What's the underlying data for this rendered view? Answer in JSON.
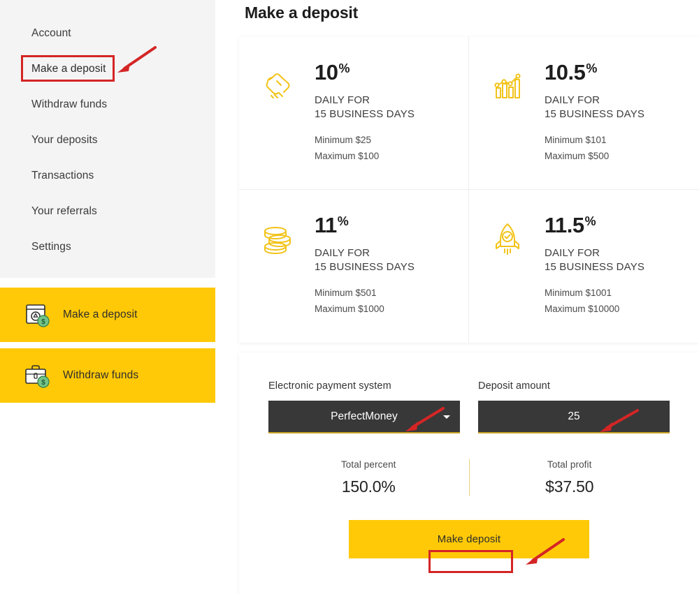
{
  "sidebar": {
    "nav_items": [
      {
        "label": "Account",
        "active": false
      },
      {
        "label": "Make a deposit",
        "active": true
      },
      {
        "label": "Withdraw funds",
        "active": false
      },
      {
        "label": "Your deposits",
        "active": false
      },
      {
        "label": "Transactions",
        "active": false
      },
      {
        "label": "Your referrals",
        "active": false
      },
      {
        "label": "Settings",
        "active": false
      }
    ],
    "action_buttons": [
      {
        "label": "Make a deposit",
        "icon": "deposit-bag-dollar-icon"
      },
      {
        "label": "Withdraw funds",
        "icon": "briefcase-dollar-icon"
      }
    ]
  },
  "main": {
    "page_title": "Make a deposit",
    "plans": [
      {
        "icon": "handshake-icon",
        "percent": "10",
        "percent_symbol": "%",
        "term_line1": "DAILY FOR",
        "term_line2": "15 BUSINESS DAYS",
        "minimum": "Minimum $25",
        "maximum": "Maximum $100"
      },
      {
        "icon": "bar-chart-trend-icon",
        "percent": "10.5",
        "percent_symbol": "%",
        "term_line1": "DAILY FOR",
        "term_line2": "15 BUSINESS DAYS",
        "minimum": "Minimum $101",
        "maximum": "Maximum $500"
      },
      {
        "icon": "coin-stack-icon",
        "percent": "11",
        "percent_symbol": "%",
        "term_line1": "DAILY FOR",
        "term_line2": "15 BUSINESS DAYS",
        "minimum": "Minimum $501",
        "maximum": "Maximum $1000"
      },
      {
        "icon": "rocket-check-icon",
        "percent": "11.5",
        "percent_symbol": "%",
        "term_line1": "DAILY FOR",
        "term_line2": "15 BUSINESS DAYS",
        "minimum": "Minimum $1001",
        "maximum": "Maximum $10000"
      }
    ],
    "form": {
      "payment_system_label": "Electronic payment system",
      "payment_system_value": "PerfectMoney",
      "payment_system_options": [
        "PerfectMoney"
      ],
      "amount_label": "Deposit amount",
      "amount_value": "25",
      "amount_placeholder": "25",
      "total_percent_label": "Total percent",
      "total_percent_value": "150.0%",
      "total_profit_label": "Total profit",
      "total_profit_value": "$37.50",
      "submit_label": "Make deposit"
    }
  },
  "colors": {
    "accent_yellow": "#FFC907",
    "annotation_red": "#d42525",
    "dark_input": "#383838",
    "sidebar_bg": "#f4f4f4"
  }
}
